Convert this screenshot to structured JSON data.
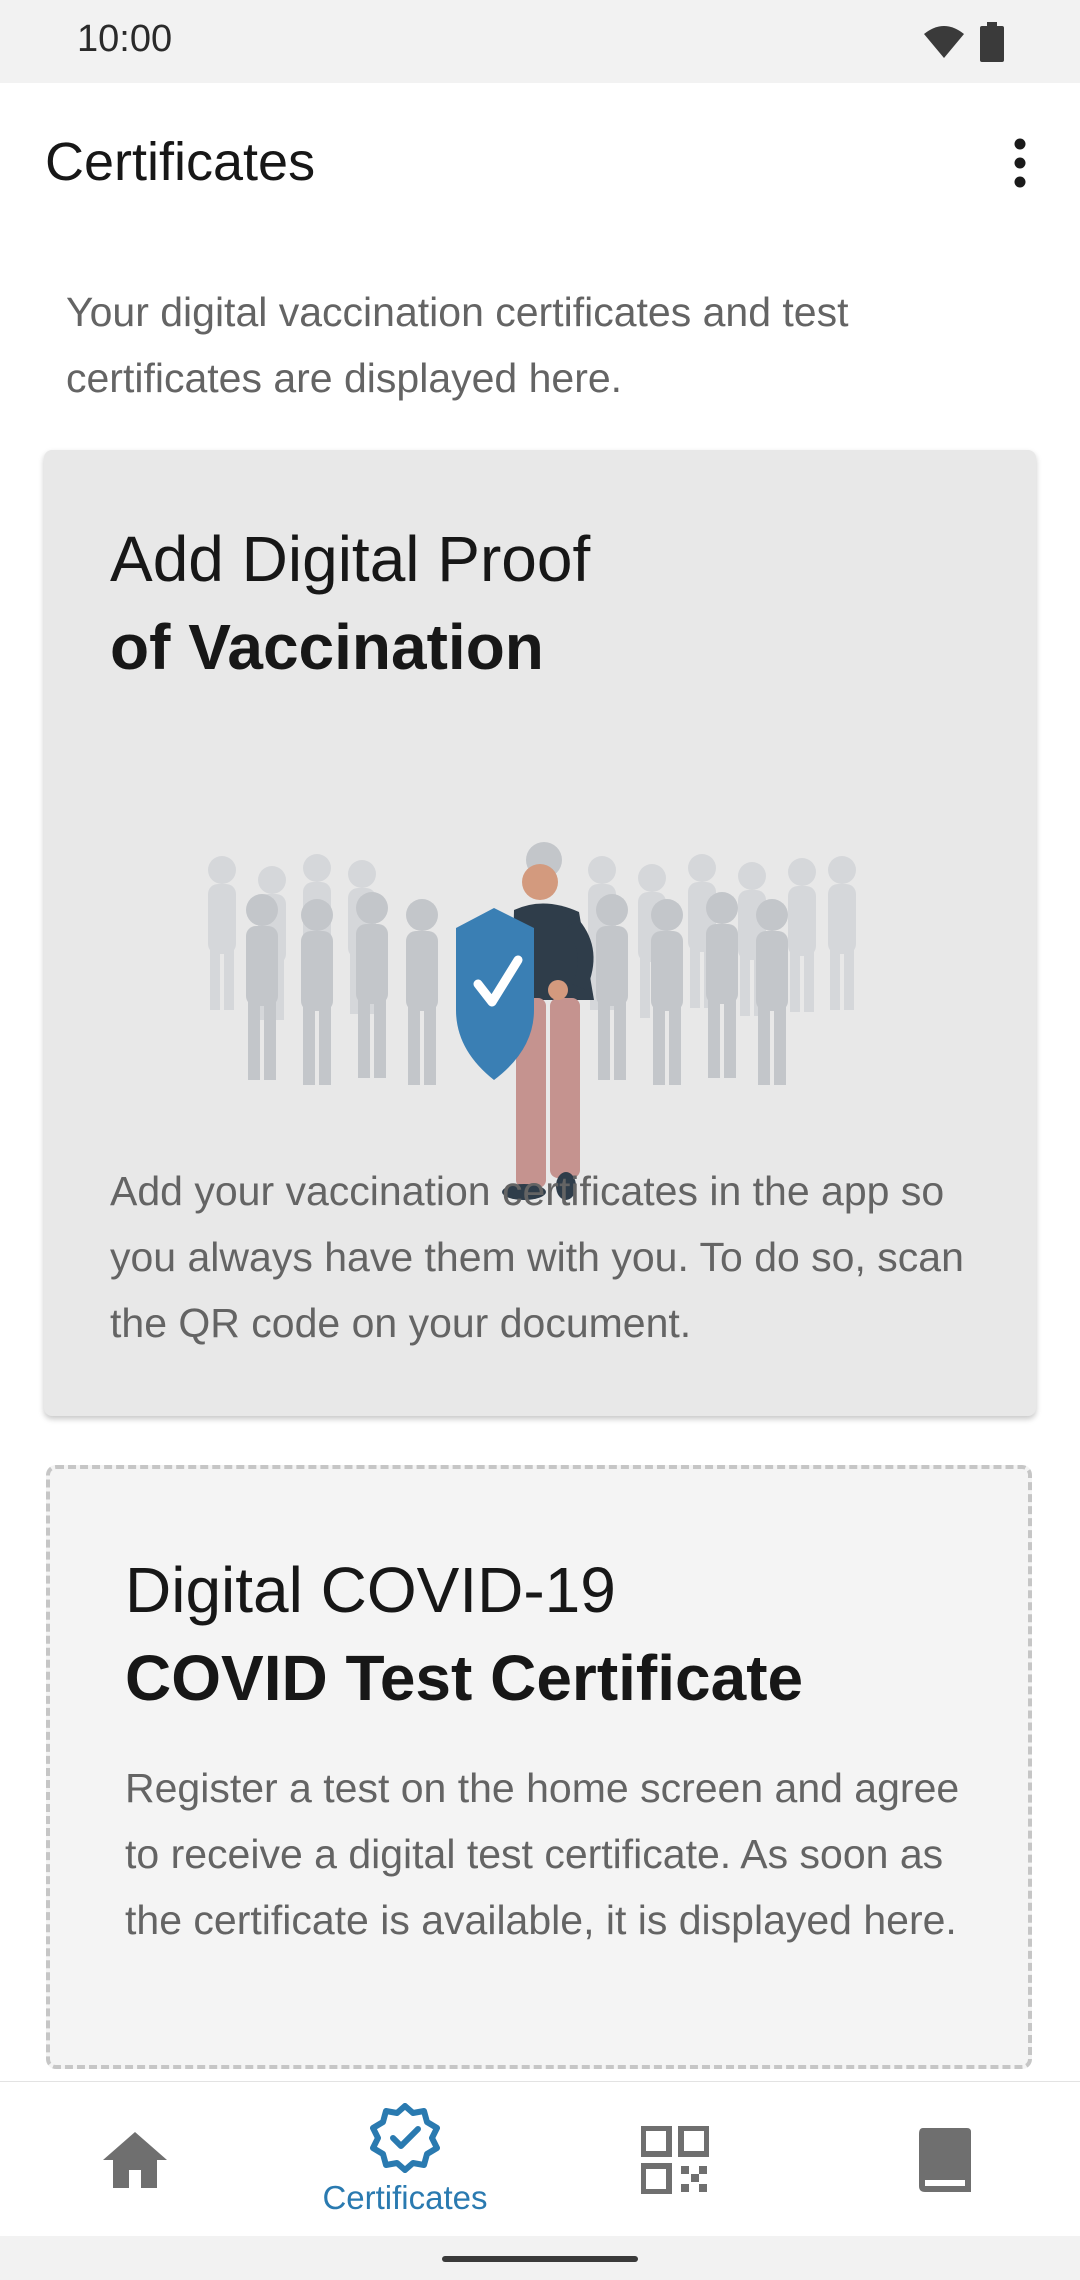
{
  "status_bar": {
    "time": "10:00",
    "icons": [
      "wifi-icon",
      "battery-icon"
    ]
  },
  "topbar": {
    "title": "Certificates",
    "menu_icon": "more-vert-icon"
  },
  "intro": {
    "text": "Your digital vaccination certificates and test certificates are displayed here."
  },
  "vaccination_card": {
    "title_light": "Add Digital Proof",
    "title_bold": "of Vaccination",
    "illustration": "person-with-shield-illustration",
    "body": "Add your vaccination certificates in the app so you always have them with you. To do so, scan the QR code on your document."
  },
  "test_card": {
    "title_light": "Digital COVID-19",
    "title_bold": "COVID Test Certificate",
    "body": "Register a test on the home screen and agree to receive a digital test certificate. As soon as the certificate is available, it is displayed here."
  },
  "bottom_nav": {
    "items": [
      {
        "icon": "home-icon",
        "label": "",
        "active": false
      },
      {
        "icon": "certificate-badge-icon",
        "label": "Certificates",
        "active": true
      },
      {
        "icon": "qr-code-icon",
        "label": "",
        "active": false
      },
      {
        "icon": "book-icon",
        "label": "",
        "active": false
      }
    ]
  },
  "colors": {
    "accent": "#2a7ab0",
    "inactive_icon": "#6f6f6f",
    "shield": "#3a7fb4"
  }
}
